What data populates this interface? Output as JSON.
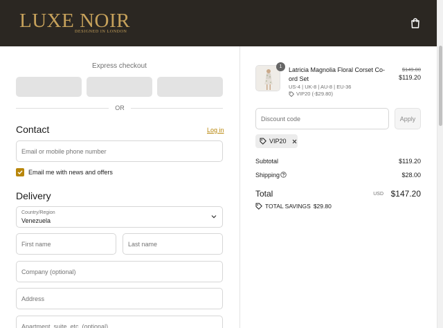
{
  "colors": {
    "header_bg": "#2b2722",
    "brand_gold": "#c6a15b",
    "accent": "#b8860b"
  },
  "header": {
    "logo_text": "LUXE NOIR",
    "logo_tagline": "DESIGNED IN LONDON",
    "cart_icon": "shopping-bag-icon"
  },
  "checkout": {
    "express_title": "Express checkout",
    "divider_text": "OR",
    "contact": {
      "title": "Contact",
      "login_label": "Log in",
      "email_placeholder": "Email or mobile phone number",
      "newsletter_label": "Email me with news and offers",
      "newsletter_checked": true
    },
    "delivery": {
      "title": "Delivery",
      "country_label": "Country/Region",
      "country_value": "Venezuela",
      "first_name_placeholder": "First name",
      "last_name_placeholder": "Last name",
      "company_placeholder": "Company (optional)",
      "address_placeholder": "Address",
      "apartment_placeholder": "Apartment, suite, etc. (optional)"
    }
  },
  "summary": {
    "item": {
      "quantity": "1",
      "name": "Latricia Magnolia Floral Corset Co-ord Set",
      "variant": "US-4 | UK-8 | AU-8 | EU-36",
      "discount": "VIP20 (-$29.80)",
      "original_price": "$149.00",
      "price": "$119.20"
    },
    "discount_placeholder": "Discount code",
    "apply_label": "Apply",
    "applied_code": "VIP20",
    "subtotal_label": "Subtotal",
    "subtotal_value": "$119.20",
    "shipping_label": "Shipping",
    "shipping_value": "$28.00",
    "total_label": "Total",
    "currency": "USD",
    "total_value": "$147.20",
    "savings_label": "TOTAL SAVINGS",
    "savings_value": "$29.80"
  }
}
